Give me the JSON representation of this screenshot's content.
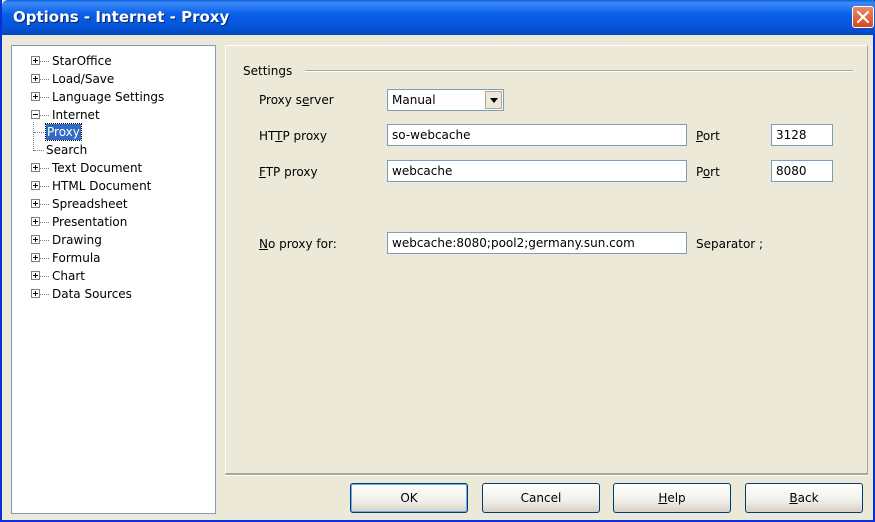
{
  "window": {
    "title": "Options - Internet - Proxy",
    "title_bar_color": "#0a5fe8",
    "close_button_color": "#d9461e"
  },
  "tree": {
    "items": [
      {
        "label": "StarOffice",
        "expanded": false
      },
      {
        "label": "Load/Save",
        "expanded": false
      },
      {
        "label": "Language Settings",
        "expanded": false
      },
      {
        "label": "Internet",
        "expanded": true
      },
      {
        "label": "Text Document",
        "expanded": false
      },
      {
        "label": "HTML Document",
        "expanded": false
      },
      {
        "label": "Spreadsheet",
        "expanded": false
      },
      {
        "label": "Presentation",
        "expanded": false
      },
      {
        "label": "Drawing",
        "expanded": false
      },
      {
        "label": "Formula",
        "expanded": false
      },
      {
        "label": "Chart",
        "expanded": false
      },
      {
        "label": "Data Sources",
        "expanded": false
      }
    ],
    "internet_children": [
      {
        "label": "Proxy",
        "selected": true
      },
      {
        "label": "Search",
        "selected": false
      }
    ],
    "selection_color": "#316ac5"
  },
  "settings": {
    "group_label": "Settings",
    "proxy_server": {
      "label_pre": "Proxy s",
      "label_ul": "e",
      "label_post": "rver",
      "value": "Manual"
    },
    "http": {
      "label_pre": "HT",
      "label_ul": "T",
      "label_post": "P proxy",
      "value": "so-webcache",
      "port_ul": "P",
      "port_post": "ort",
      "port_value": "3128"
    },
    "ftp": {
      "label_pre": "",
      "label_ul": "F",
      "label_post": "TP proxy",
      "value": "webcache",
      "port_pre": "P",
      "port_ul": "o",
      "port_post": "rt",
      "port_value": "8080"
    },
    "no_proxy": {
      "label_ul": "N",
      "label_post": "o proxy for:",
      "value": "webcache:8080;pool2;germany.sun.com",
      "separator": "Separator ;"
    }
  },
  "buttons": {
    "ok": "OK",
    "cancel": "Cancel",
    "help_ul": "H",
    "help_post": "elp",
    "back_ul": "B",
    "back_post": "ack"
  }
}
